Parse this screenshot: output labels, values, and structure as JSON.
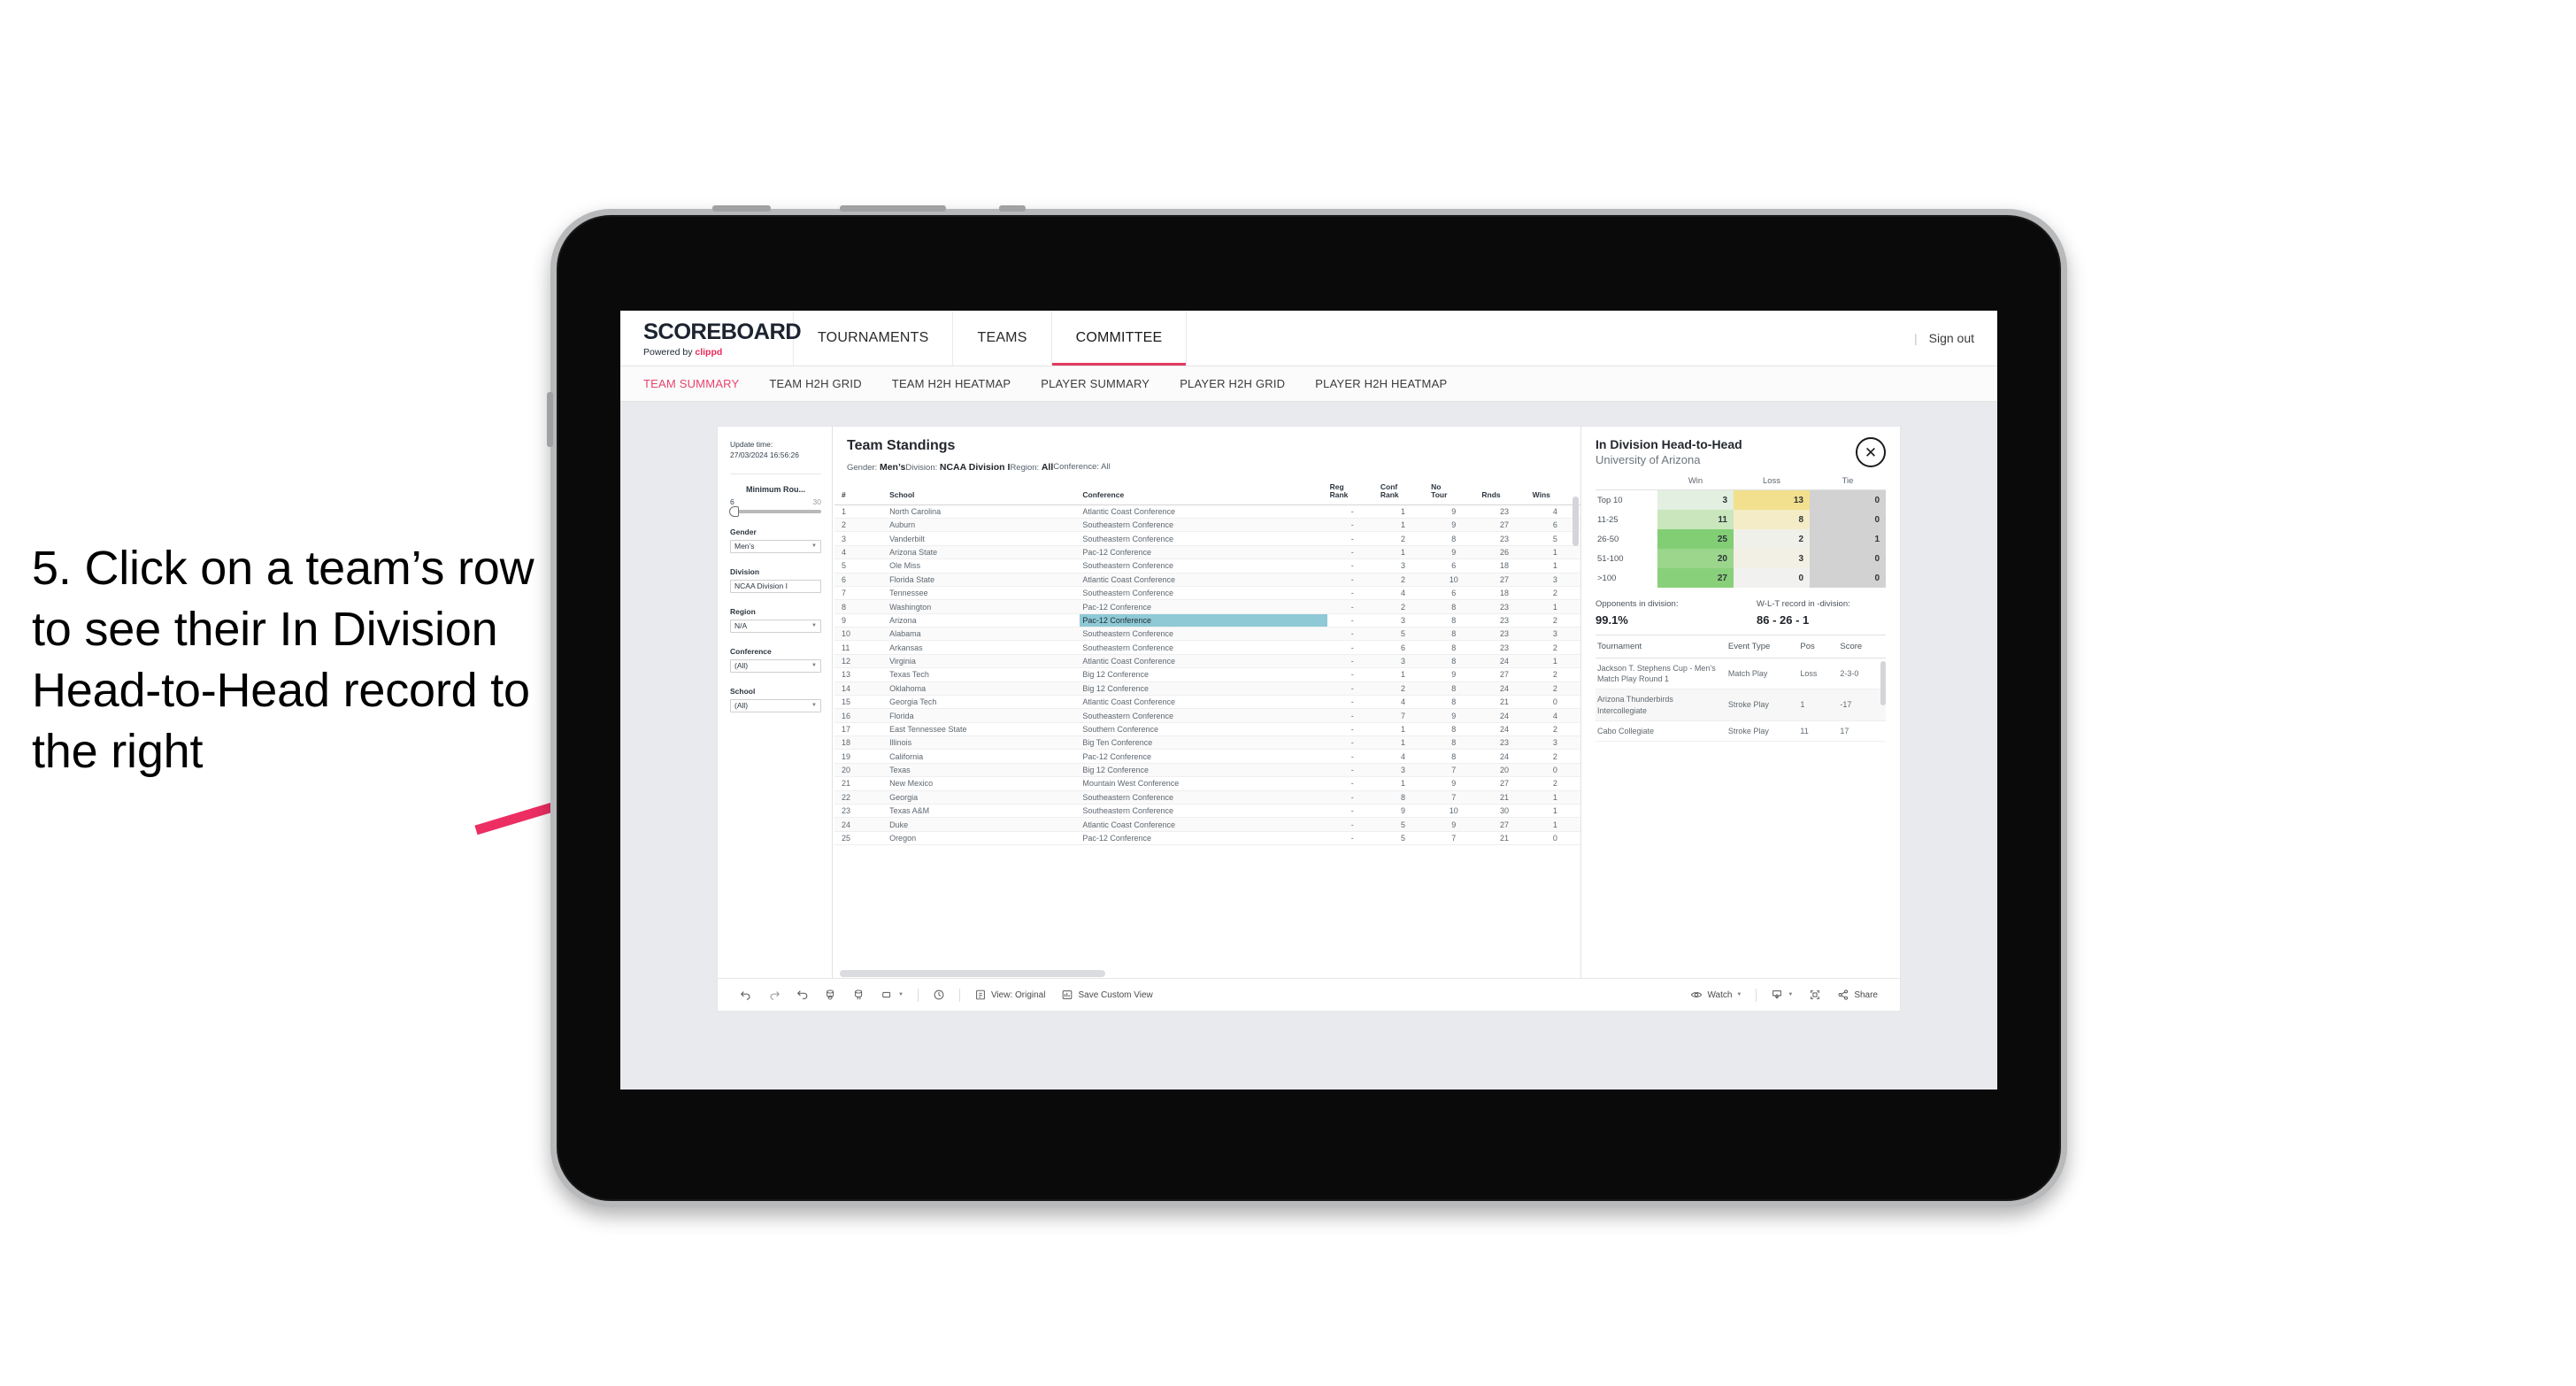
{
  "annotation": {
    "text": "5. Click on a team’s row to see their In Division Head-to-Head record to the right",
    "arrow_color": "#ec2e62"
  },
  "app": {
    "logo": {
      "word": "SCOREBOARD",
      "powered_prefix": "Powered by ",
      "powered_brand": "clippd"
    },
    "top_nav": [
      {
        "label": "TOURNAMENTS",
        "active": false
      },
      {
        "label": "TEAMS",
        "active": false
      },
      {
        "label": "COMMITTEE",
        "active": true
      }
    ],
    "sign_out": "Sign out",
    "sub_tabs": [
      {
        "label": "TEAM SUMMARY",
        "active": true
      },
      {
        "label": "TEAM H2H GRID",
        "active": false
      },
      {
        "label": "TEAM H2H HEATMAP",
        "active": false
      },
      {
        "label": "PLAYER SUMMARY",
        "active": false
      },
      {
        "label": "PLAYER H2H GRID",
        "active": false
      },
      {
        "label": "PLAYER H2H HEATMAP",
        "active": false
      }
    ]
  },
  "filters": {
    "update_time_label": "Update time:",
    "update_time_value": "27/03/2024 16:56:26",
    "min_rounds": {
      "label": "Minimum Rou...",
      "min": "6",
      "max": "30"
    },
    "groups": [
      {
        "label": "Gender",
        "value": "Men’s"
      },
      {
        "label": "Division",
        "value": "NCAA Division I"
      },
      {
        "label": "Region",
        "value": "N/A"
      },
      {
        "label": "Conference",
        "value": "(All)"
      },
      {
        "label": "School",
        "value": "(All)"
      }
    ]
  },
  "standings": {
    "title": "Team Standings",
    "filter_summary": [
      {
        "label": "Gender: ",
        "value": "Men’s"
      },
      {
        "label": "Division: ",
        "value": "NCAA Division I"
      },
      {
        "label": "Region: ",
        "value": "All"
      },
      {
        "label": "Conference: ",
        "value": "All"
      }
    ],
    "columns": [
      "#",
      "School",
      "Conference",
      "Reg Rank",
      "Conf Rank",
      "No Tour",
      "Rnds",
      "Wins"
    ],
    "selected_row_index": 8,
    "rows": [
      [
        "1",
        "North Carolina",
        "Atlantic Coast Conference",
        "-",
        "1",
        "9",
        "23",
        "4"
      ],
      [
        "2",
        "Auburn",
        "Southeastern Conference",
        "-",
        "1",
        "9",
        "27",
        "6"
      ],
      [
        "3",
        "Vanderbilt",
        "Southeastern Conference",
        "-",
        "2",
        "8",
        "23",
        "5"
      ],
      [
        "4",
        "Arizona State",
        "Pac-12 Conference",
        "-",
        "1",
        "9",
        "26",
        "1"
      ],
      [
        "5",
        "Ole Miss",
        "Southeastern Conference",
        "-",
        "3",
        "6",
        "18",
        "1"
      ],
      [
        "6",
        "Florida State",
        "Atlantic Coast Conference",
        "-",
        "2",
        "10",
        "27",
        "3"
      ],
      [
        "7",
        "Tennessee",
        "Southeastern Conference",
        "-",
        "4",
        "6",
        "18",
        "2"
      ],
      [
        "8",
        "Washington",
        "Pac-12 Conference",
        "-",
        "2",
        "8",
        "23",
        "1"
      ],
      [
        "9",
        "Arizona",
        "Pac-12 Conference",
        "-",
        "3",
        "8",
        "23",
        "2"
      ],
      [
        "10",
        "Alabama",
        "Southeastern Conference",
        "-",
        "5",
        "8",
        "23",
        "3"
      ],
      [
        "11",
        "Arkansas",
        "Southeastern Conference",
        "-",
        "6",
        "8",
        "23",
        "2"
      ],
      [
        "12",
        "Virginia",
        "Atlantic Coast Conference",
        "-",
        "3",
        "8",
        "24",
        "1"
      ],
      [
        "13",
        "Texas Tech",
        "Big 12 Conference",
        "-",
        "1",
        "9",
        "27",
        "2"
      ],
      [
        "14",
        "Oklahoma",
        "Big 12 Conference",
        "-",
        "2",
        "8",
        "24",
        "2"
      ],
      [
        "15",
        "Georgia Tech",
        "Atlantic Coast Conference",
        "-",
        "4",
        "8",
        "21",
        "0"
      ],
      [
        "16",
        "Florida",
        "Southeastern Conference",
        "-",
        "7",
        "9",
        "24",
        "4"
      ],
      [
        "17",
        "East Tennessee State",
        "Southern Conference",
        "-",
        "1",
        "8",
        "24",
        "2"
      ],
      [
        "18",
        "Illinois",
        "Big Ten Conference",
        "-",
        "1",
        "8",
        "23",
        "3"
      ],
      [
        "19",
        "California",
        "Pac-12 Conference",
        "-",
        "4",
        "8",
        "24",
        "2"
      ],
      [
        "20",
        "Texas",
        "Big 12 Conference",
        "-",
        "3",
        "7",
        "20",
        "0"
      ],
      [
        "21",
        "New Mexico",
        "Mountain West Conference",
        "-",
        "1",
        "9",
        "27",
        "2"
      ],
      [
        "22",
        "Georgia",
        "Southeastern Conference",
        "-",
        "8",
        "7",
        "21",
        "1"
      ],
      [
        "23",
        "Texas A&M",
        "Southeastern Conference",
        "-",
        "9",
        "10",
        "30",
        "1"
      ],
      [
        "24",
        "Duke",
        "Atlantic Coast Conference",
        "-",
        "5",
        "9",
        "27",
        "1"
      ],
      [
        "25",
        "Oregon",
        "Pac-12 Conference",
        "-",
        "5",
        "7",
        "21",
        "0"
      ]
    ]
  },
  "h2h": {
    "title": "In Division Head-to-Head",
    "subtitle": "University of Arizona",
    "close_icon": "close-icon",
    "heatmap": {
      "columns": [
        "Win",
        "Loss",
        "Tie"
      ],
      "rows": [
        {
          "label": "Top 10",
          "win": "3",
          "loss": "13",
          "tie": "0",
          "win_color": "#e2efe1",
          "loss_color": "#f2e08e",
          "tie_color": "#d2d2d2"
        },
        {
          "label": "11-25",
          "win": "11",
          "loss": "8",
          "tie": "0",
          "win_color": "#c9e6bd",
          "loss_color": "#f4ecc6",
          "tie_color": "#d2d2d2"
        },
        {
          "label": "26-50",
          "win": "25",
          "loss": "2",
          "tie": "1",
          "win_color": "#82ce75",
          "loss_color": "#f0f0ea",
          "tie_color": "#d2d2d2"
        },
        {
          "label": "51-100",
          "win": "20",
          "loss": "3",
          "tie": "0",
          "win_color": "#9bd68c",
          "loss_color": "#f2efe4",
          "tie_color": "#d2d2d2"
        },
        {
          "label": ">100",
          "win": "27",
          "loss": "0",
          "tie": "0",
          "win_color": "#89d07b",
          "loss_color": "#f1f1ef",
          "tie_color": "#d2d2d2"
        }
      ]
    },
    "stats": [
      {
        "label": "Opponents in division:",
        "value": "99.1%"
      },
      {
        "label": "W-L-T record in -division:",
        "value": "86 - 26 - 1"
      }
    ],
    "tournament_columns": [
      "Tournament",
      "Event Type",
      "Pos",
      "Score"
    ],
    "tournaments": [
      [
        "Jackson T. Stephens Cup - Men’s Match Play Round 1",
        "Match Play",
        "Loss",
        "2-3-0"
      ],
      [
        "Arizona Thunderbirds Intercollegiate",
        "Stroke Play",
        "1",
        "-17"
      ],
      [
        "Cabo Collegiate",
        "Stroke Play",
        "11",
        "17"
      ]
    ]
  },
  "viz_toolbar": {
    "left_icons": [
      "undo-icon",
      "redo-icon",
      "revert-icon",
      "refresh-data-icon",
      "pause-updates-icon",
      "rectangle-select-icon"
    ],
    "clock_icon": "clock-icon",
    "view_label": "View: Original",
    "save_view_label": "Save Custom View",
    "watch_label": "Watch",
    "download_icon": "download-icon",
    "fullscreen_icon": "fullscreen-icon",
    "share_label": "Share"
  }
}
